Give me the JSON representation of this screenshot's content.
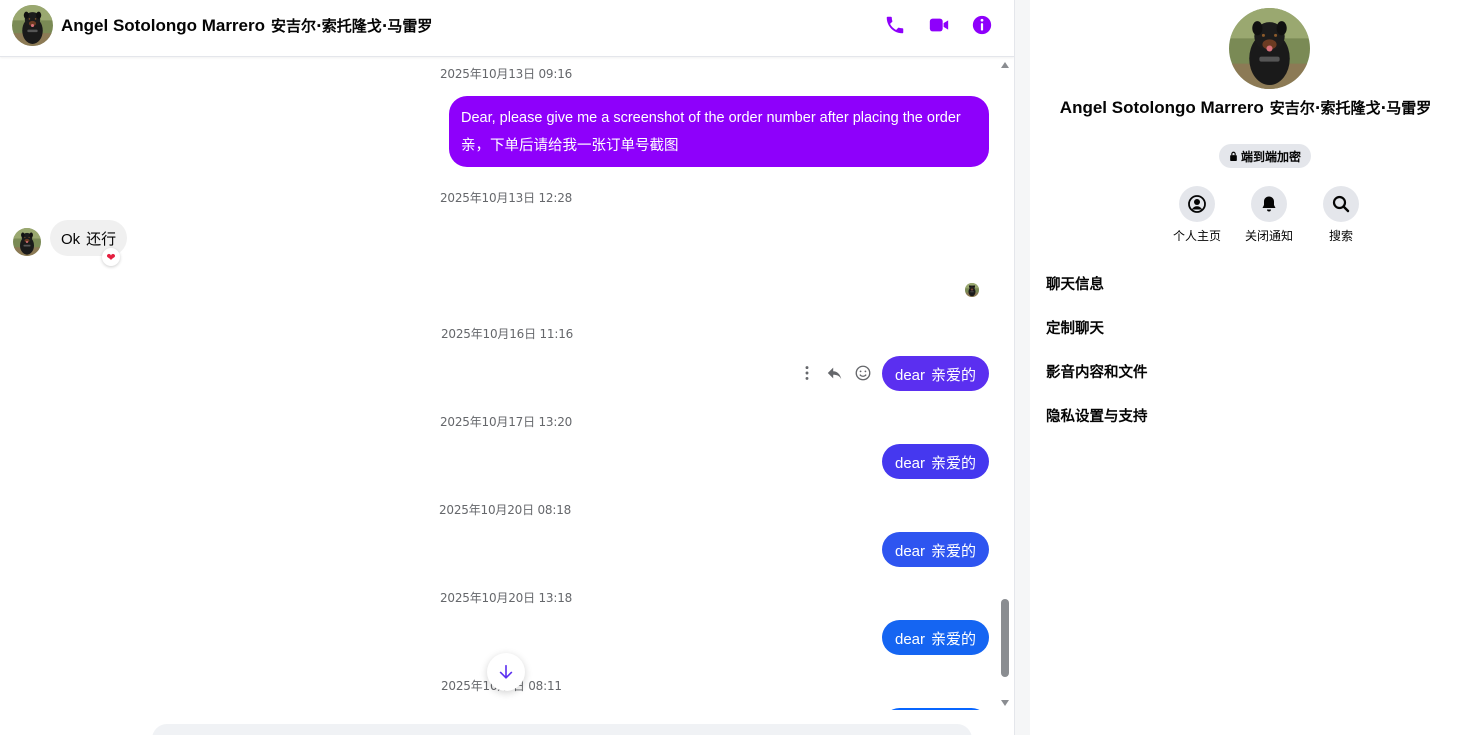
{
  "colors": {
    "accent": "#8e00fb",
    "gradient_purple": "#8e00fb",
    "gradient_indigo": "#5b2ff0",
    "gradient_blue": "#2e55f0",
    "brand_blue": "#0866ff",
    "received_bubble": "#f0f0f0"
  },
  "header": {
    "name": "Angel Sotolongo Marrero",
    "alt_name": "安吉尔·索托隆戈·马雷罗",
    "icons": [
      "phone-icon",
      "video-camera-icon",
      "info-icon"
    ]
  },
  "messages": {
    "ts1": "2025年10月13日 09:16",
    "msg1_line1": "Dear, please give me a screenshot of the order number after placing the order",
    "msg1_line2": "亲，下单后请给我一张订单号截图",
    "ts2": "2025年10月13日 12:28",
    "recv_text": "Ok",
    "recv_zh": "还行",
    "reaction": "❤",
    "ts3": "2025年10月16日 11:16",
    "dear_en": "dear",
    "dear_zh": "亲爱的",
    "ts4": "2025年10月17日 13:20",
    "ts5": "2025年10月20日 08:18",
    "ts6": "2025年10月20日 13:18",
    "ts7": "2025年10月  日 08:11"
  },
  "info": {
    "name": "Angel Sotolongo Marrero",
    "alt_name": "安吉尔·索托隆戈·马雷罗",
    "e2e": "端到端加密",
    "actions": {
      "profile": "个人主页",
      "mute": "关闭通知",
      "search": "搜索"
    },
    "sections": {
      "chat_info": "聊天信息",
      "customize": "定制聊天",
      "media": "影音内容和文件",
      "privacy": "隐私设置与支持"
    }
  }
}
